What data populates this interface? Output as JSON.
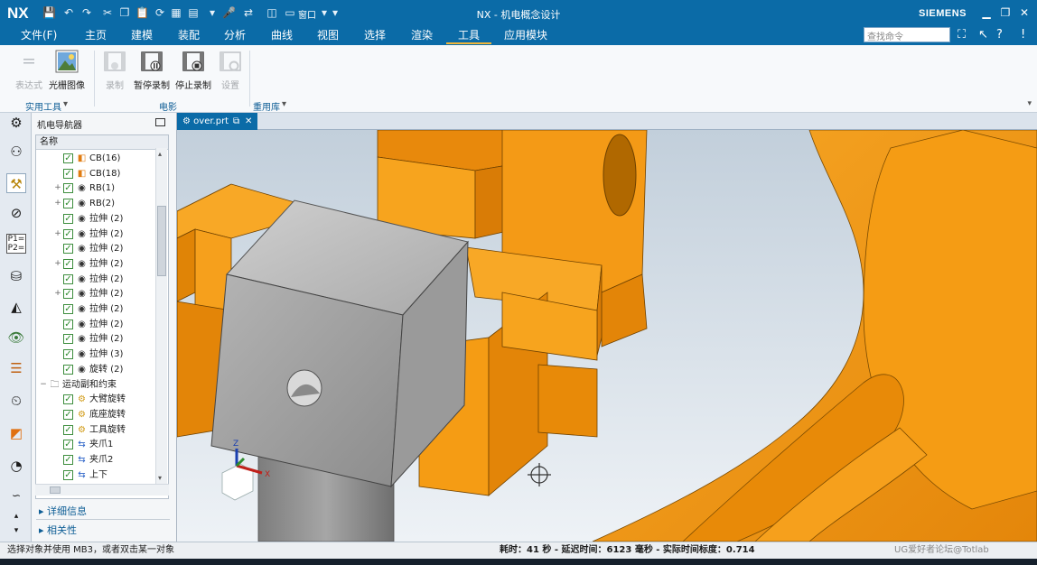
{
  "app": {
    "logo": "NX",
    "window_title": "NX - 机电概念设计",
    "brand": "SIEMENS",
    "window_menu": "窗口"
  },
  "menu": {
    "items": [
      "文件(F)",
      "主页",
      "建模",
      "装配",
      "分析",
      "曲线",
      "视图",
      "选择",
      "渲染",
      "工具",
      "应用模块"
    ],
    "active": "工具",
    "search_placeholder": "查找命令"
  },
  "ribbon": {
    "buttons": [
      {
        "label": "表达式",
        "disabled": true
      },
      {
        "label": "光栅图像",
        "disabled": false
      },
      {
        "label": "录制",
        "disabled": true
      },
      {
        "label": "暂停录制",
        "disabled": false
      },
      {
        "label": "停止录制",
        "disabled": false
      },
      {
        "label": "设置",
        "disabled": true
      }
    ],
    "groups": [
      "实用工具",
      "电影",
      "重用库"
    ]
  },
  "navigator": {
    "title": "机电导航器",
    "column_header": "名称",
    "rows": [
      {
        "label": "CB(16)",
        "icon": "rigid-body-cube-icon",
        "expand": ""
      },
      {
        "label": "CB(18)",
        "icon": "rigid-body-cube-icon",
        "expand": ""
      },
      {
        "label": "RB(1)",
        "icon": "eye-icon",
        "expand": "+"
      },
      {
        "label": "RB(2)",
        "icon": "eye-icon",
        "expand": "+"
      },
      {
        "label": "拉伸 (2)",
        "icon": "eye-icon",
        "expand": ""
      },
      {
        "label": "拉伸 (2)",
        "icon": "eye-icon",
        "expand": "+"
      },
      {
        "label": "拉伸 (2)",
        "icon": "eye-icon",
        "expand": ""
      },
      {
        "label": "拉伸 (2)",
        "icon": "eye-icon",
        "expand": "+"
      },
      {
        "label": "拉伸 (2)",
        "icon": "eye-icon",
        "expand": ""
      },
      {
        "label": "拉伸 (2)",
        "icon": "eye-icon",
        "expand": "+"
      },
      {
        "label": "拉伸 (2)",
        "icon": "eye-icon",
        "expand": ""
      },
      {
        "label": "拉伸 (2)",
        "icon": "eye-icon",
        "expand": ""
      },
      {
        "label": "拉伸 (2)",
        "icon": "eye-icon",
        "expand": ""
      },
      {
        "label": "拉伸 (3)",
        "icon": "eye-icon",
        "expand": ""
      },
      {
        "label": "旋转 (2)",
        "icon": "eye-icon",
        "expand": ""
      },
      {
        "label": "运动副和约束",
        "icon": "folder-icon",
        "expand": "−",
        "group": true
      },
      {
        "label": "大臂旋转",
        "icon": "hinge-joint-icon",
        "expand": ""
      },
      {
        "label": "底座旋转",
        "icon": "hinge-joint-icon",
        "expand": ""
      },
      {
        "label": "工具旋转",
        "icon": "hinge-joint-icon",
        "expand": ""
      },
      {
        "label": "夹爪1",
        "icon": "sliding-joint-icon",
        "expand": ""
      },
      {
        "label": "夹爪2",
        "icon": "sliding-joint-icon",
        "expand": ""
      },
      {
        "label": "上下",
        "icon": "sliding-joint-icon",
        "expand": ""
      }
    ],
    "sections": [
      "详细信息",
      "相关性"
    ]
  },
  "viewport": {
    "tab_label": "over.prt",
    "triad_z": "Z",
    "triad_x": "X"
  },
  "status": {
    "prompt": "选择对象并使用 MB3，或者双击某一对象",
    "timing": "耗时：41 秒 - 延迟时间：6123 毫秒 - 实际时间标度：0.714",
    "watermark": "UG爱好者论坛@Totlab"
  },
  "colors": {
    "accent": "#0b6ba7",
    "orange_part": "#f39a12",
    "gray_part": "#a9a9a9",
    "active_tab_underline": "#f1b63a"
  }
}
